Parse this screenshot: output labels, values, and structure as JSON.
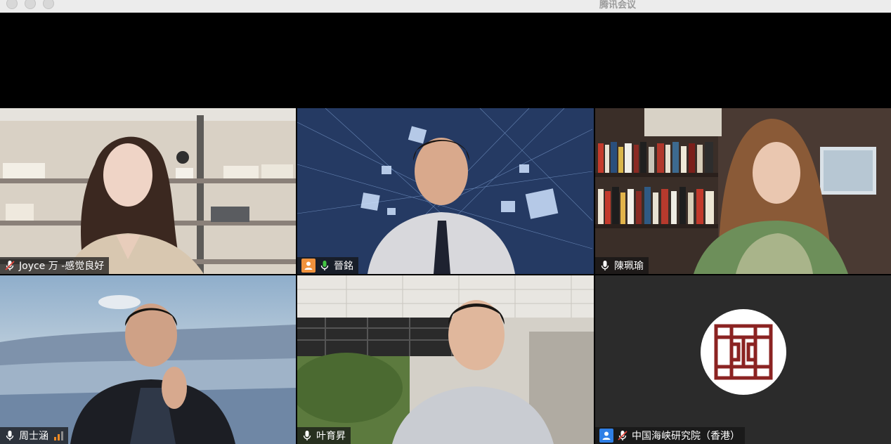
{
  "window": {
    "title": "腾讯会议"
  },
  "tiles": [
    {
      "name": "Joyce 万 -感觉良好",
      "mic": "muted",
      "avatar": ""
    },
    {
      "name": "晉銘",
      "mic": "on",
      "avatar": "orange",
      "speaking": true
    },
    {
      "name": "陳珮瑜",
      "mic": "on",
      "avatar": ""
    },
    {
      "name": "周士涵",
      "mic": "on",
      "avatar": "",
      "signal": "weak"
    },
    {
      "name": "叶育昇",
      "mic": "on",
      "avatar": ""
    },
    {
      "name": "中国海峡研究院（香港）",
      "mic": "muted",
      "avatar": "blue",
      "video": "off"
    }
  ],
  "colors": {
    "speaking_border": "#4fbf4f",
    "avatar_orange": "#f0923c",
    "avatar_blue": "#2f7fe6",
    "logo_red": "#8b2322",
    "signal_orange": "#f08a24"
  }
}
